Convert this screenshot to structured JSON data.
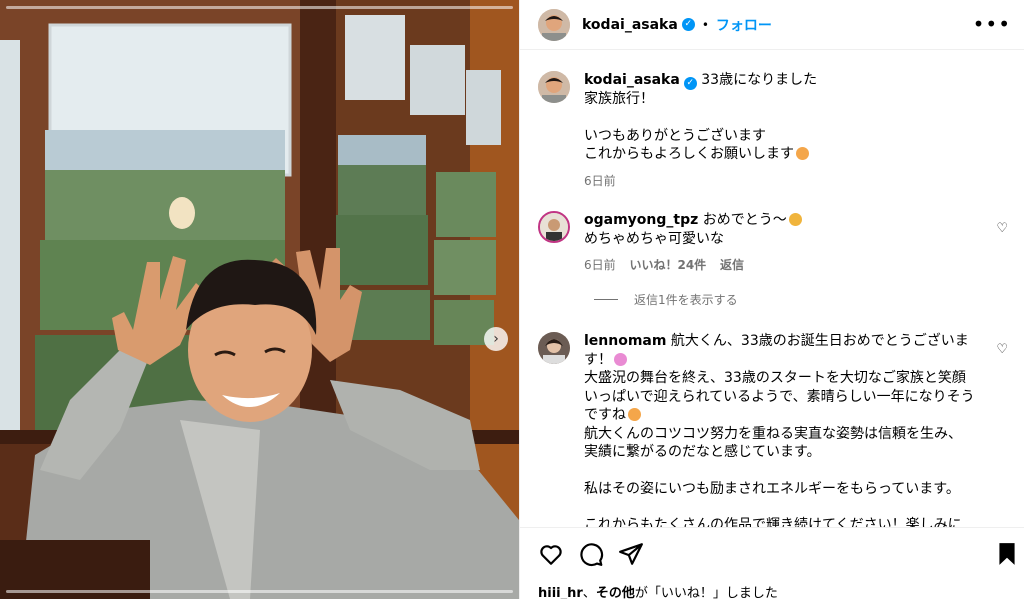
{
  "post": {
    "author": "kodai_asaka",
    "follow_label": "フォロー",
    "dot": "•",
    "more": "•••"
  },
  "caption": {
    "username": "kodai_asaka",
    "lines": [
      "33歳になりました",
      "家族旅行！",
      "",
      "いつもありがとうございます",
      "これからもよろしくお願いします"
    ],
    "emoji": "face-savoring-emoji",
    "time": "6日前"
  },
  "comments": [
    {
      "username": "ogamyong_tpz",
      "lines": [
        "おめでとう〜",
        "めちゃめちゃ可愛いな"
      ],
      "emoji": "face-heart-eyes-emoji",
      "time": "6日前",
      "likes": "いいね！24件",
      "reply": "返信",
      "view_replies": "返信1件を表示する"
    },
    {
      "username": "lennomam",
      "lines": [
        "航大くん、33歳のお誕生日おめでとうございま",
        "す！",
        "大盛況の舞台を終え、33歳のスタートを大切なご家族と笑顔",
        "いっぱいで迎えられているようで、素晴らしい一年になりそう",
        "ですね",
        "航大くんのコツコツ努力を重ねる実直な姿勢は信頼を生み、",
        "実績に繋がるのだなと感じています。",
        "",
        "私はその姿にいつも励まされエネルギーをもらっています。",
        "",
        "これからもたくさんの作品で輝き続けてください！楽しみに"
      ],
      "emoji": "party-popper-emoji"
    }
  ],
  "liked_by": {
    "user": "hiii_hr",
    "connector": "、",
    "others": "その他",
    "suffix": "が「いいね！」しました"
  },
  "icons": {
    "verified": "✓",
    "heart": "♡",
    "next": "›"
  }
}
